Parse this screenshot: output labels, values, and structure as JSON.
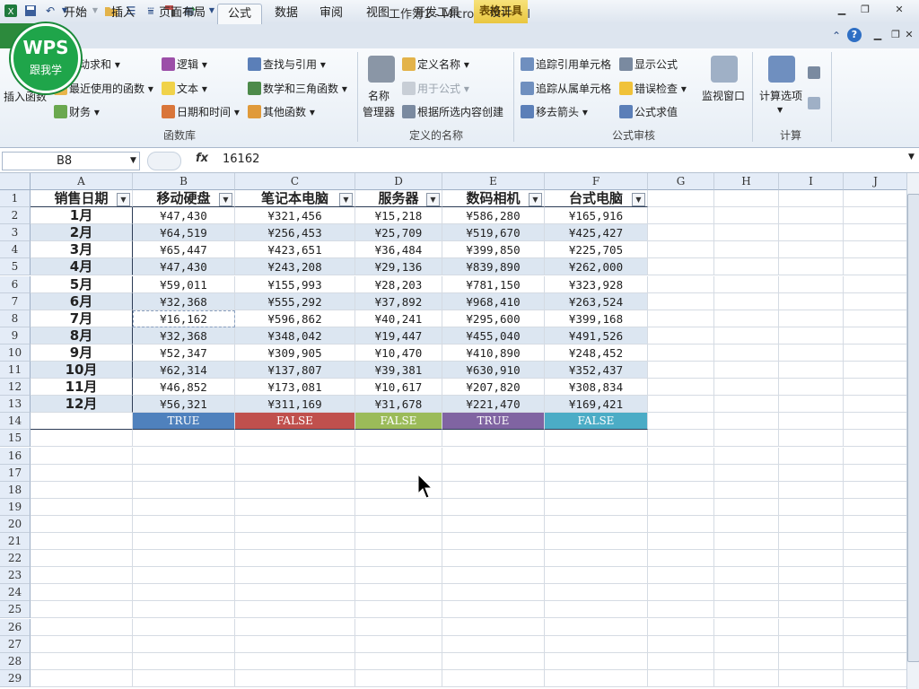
{
  "window": {
    "title": "工作簿1 - Microsoft Excel",
    "contextual_tab_group": "表格工具"
  },
  "logo": {
    "text": "WPS",
    "subtitle": "跟我学"
  },
  "tabs": [
    {
      "label": "开始"
    },
    {
      "label": "插入"
    },
    {
      "label": "页面布局"
    },
    {
      "label": "公式",
      "active": true
    },
    {
      "label": "数据"
    },
    {
      "label": "审阅"
    },
    {
      "label": "视图"
    },
    {
      "label": "开发工具"
    },
    {
      "label": "设计"
    }
  ],
  "ribbon": {
    "function_library": {
      "group_label": "函数库",
      "insert_function": "插入函数",
      "autosum": "自动求和",
      "recent": "最近使用的函数",
      "financial": "财务",
      "logical": "逻辑",
      "text": "文本",
      "datetime": "日期和时间",
      "lookup": "查找与引用",
      "math": "数学和三角函数",
      "other": "其他函数"
    },
    "defined_names": {
      "group_label": "定义的名称",
      "name_manager_line1": "名称",
      "name_manager_line2": "管理器",
      "define_name": "定义名称",
      "use_in_formula": "用于公式",
      "create_from_selection": "根据所选内容创建"
    },
    "formula_auditing": {
      "group_label": "公式审核",
      "trace_precedents": "追踪引用单元格",
      "trace_dependents": "追踪从属单元格",
      "remove_arrows": "移去箭头",
      "show_formulas": "显示公式",
      "error_checking": "错误检查",
      "evaluate_formula": "公式求值",
      "watch_window": "监视窗口"
    },
    "calculation": {
      "group_label": "计算",
      "calc_options": "计算选项"
    }
  },
  "formula_bar": {
    "name_box": "B8",
    "fx_label": "fx",
    "value": "16162"
  },
  "columns": [
    "A",
    "B",
    "C",
    "D",
    "E",
    "F",
    "G",
    "H",
    "I",
    "J"
  ],
  "rows": [
    "1",
    "2",
    "3",
    "4",
    "5",
    "6",
    "7",
    "8",
    "9",
    "10",
    "11",
    "12",
    "13",
    "14",
    "15",
    "16",
    "17",
    "18",
    "19",
    "20",
    "21",
    "22",
    "23",
    "24",
    "25",
    "26",
    "27",
    "28",
    "29"
  ],
  "table": {
    "headers": [
      "销售日期",
      "移动硬盘",
      "笔记本电脑",
      "服务器",
      "数码相机",
      "台式电脑"
    ],
    "data": [
      [
        "1月",
        "¥47,430",
        "¥321,456",
        "¥15,218",
        "¥586,280",
        "¥165,916"
      ],
      [
        "2月",
        "¥64,519",
        "¥256,453",
        "¥25,709",
        "¥519,670",
        "¥425,427"
      ],
      [
        "3月",
        "¥65,447",
        "¥423,651",
        "¥36,484",
        "¥399,850",
        "¥225,705"
      ],
      [
        "4月",
        "¥47,430",
        "¥243,208",
        "¥29,136",
        "¥839,890",
        "¥262,000"
      ],
      [
        "5月",
        "¥59,011",
        "¥155,993",
        "¥28,203",
        "¥781,150",
        "¥323,928"
      ],
      [
        "6月",
        "¥32,368",
        "¥555,292",
        "¥37,892",
        "¥968,410",
        "¥263,524"
      ],
      [
        "7月",
        "¥16,162",
        "¥596,862",
        "¥40,241",
        "¥295,600",
        "¥399,168"
      ],
      [
        "8月",
        "¥32,368",
        "¥348,042",
        "¥19,447",
        "¥455,040",
        "¥491,526"
      ],
      [
        "9月",
        "¥52,347",
        "¥309,905",
        "¥10,470",
        "¥410,890",
        "¥248,452"
      ],
      [
        "10月",
        "¥62,314",
        "¥137,807",
        "¥39,381",
        "¥630,910",
        "¥352,437"
      ],
      [
        "11月",
        "¥46,852",
        "¥173,081",
        "¥10,617",
        "¥207,820",
        "¥308,834"
      ],
      [
        "12月",
        "¥56,321",
        "¥311,169",
        "¥31,678",
        "¥221,470",
        "¥169,421"
      ]
    ],
    "flags": [
      "",
      "TRUE",
      "FALSE",
      "FALSE",
      "TRUE",
      "FALSE"
    ],
    "flag_colors": [
      "",
      "#4f81bd",
      "#c0504d",
      "#9bbb59",
      "#8064a2",
      "#4bacc6"
    ]
  }
}
